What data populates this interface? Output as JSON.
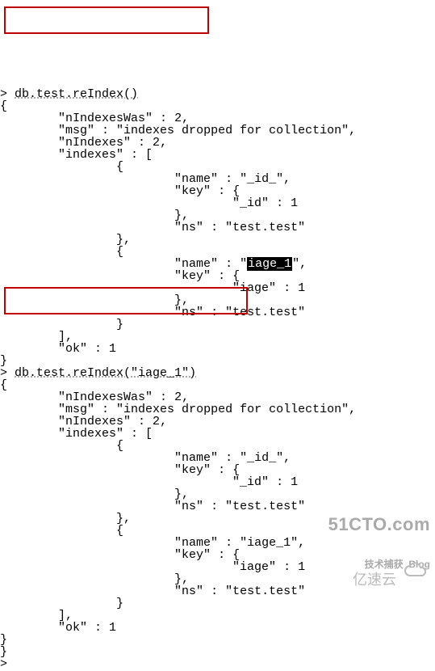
{
  "prompt_char": ">",
  "blocks": [
    {
      "command": "db.test.reIndex()",
      "open_brace": "{",
      "nIndexesWas_label": "\"nIndexesWas\"",
      "nIndexesWas_value": "2",
      "msg_label": "\"msg\"",
      "msg_value": "\"indexes dropped for collection\"",
      "nIndexes_label": "\"nIndexes\"",
      "nIndexes_value": "2",
      "indexes_label": "\"indexes\"",
      "indexes_open": "[",
      "item1": {
        "open": "{",
        "name_label": "\"name\"",
        "name_value": "\"_id_\"",
        "key_label": "\"key\"",
        "key_open": "{",
        "key_field": "\"_id\"",
        "key_val": "1",
        "key_close": "},",
        "ns_label": "\"ns\"",
        "ns_value": "\"test.test\"",
        "close": "},"
      },
      "item2": {
        "open": "{",
        "name_label": "\"name\"",
        "name_value_pre": "\"",
        "name_value_hl": "iage_1",
        "name_value_post": "\"",
        "key_label": "\"key\"",
        "key_open": "{",
        "key_field": "\"iage\"",
        "key_val": "1",
        "key_close": "},",
        "ns_label": "\"ns\"",
        "ns_value": "\"test.test\"",
        "close": "}"
      },
      "indexes_close": "],",
      "ok_label": "\"ok\"",
      "ok_value": "1",
      "close_brace": "}"
    },
    {
      "command": "db.test.reIndex(\"iage_1\")",
      "open_brace": "{",
      "nIndexesWas_label": "\"nIndexesWas\"",
      "nIndexesWas_value": "2",
      "msg_label": "\"msg\"",
      "msg_value": "\"indexes dropped for collection\"",
      "nIndexes_label": "\"nIndexes\"",
      "nIndexes_value": "2",
      "indexes_label": "\"indexes\"",
      "indexes_open": "[",
      "item1": {
        "open": "{",
        "name_label": "\"name\"",
        "name_value": "\"_id_\"",
        "key_label": "\"key\"",
        "key_open": "{",
        "key_field": "\"_id\"",
        "key_val": "1",
        "key_close": "},",
        "ns_label": "\"ns\"",
        "ns_value": "\"test.test\"",
        "close": "},"
      },
      "item2": {
        "open": "{",
        "name_label": "\"name\"",
        "name_value": "\"iage_1\"",
        "key_label": "\"key\"",
        "key_open": "{",
        "key_field": "\"iage\"",
        "key_val": "1",
        "key_close": "},",
        "ns_label": "\"ns\"",
        "ns_value": "\"test.test\"",
        "close": "}"
      },
      "indexes_close": "],",
      "ok_label": "\"ok\"",
      "ok_value": "1",
      "close_brace": "}"
    }
  ],
  "trailing_top": "}",
  "trailing_prompt": ">",
  "watermark": {
    "main": "51CTO.com",
    "sub_left": "技术捕获",
    "sub_right": "Blog",
    "cloud_text": "亿速云"
  }
}
